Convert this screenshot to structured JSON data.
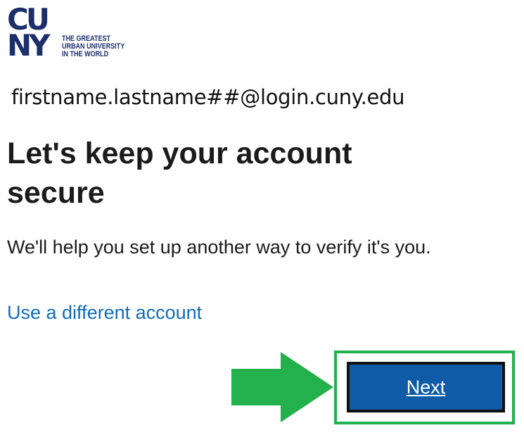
{
  "logo": {
    "letters_top": "CU",
    "letters_bottom": "NY",
    "tagline": [
      "THE GREATEST",
      "URBAN UNIVERSITY",
      "IN THE WORLD"
    ],
    "color": "#1d2f6b"
  },
  "account": {
    "email": "firstname.lastname##@login.cuny.edu"
  },
  "page": {
    "title": "Let's keep your account secure",
    "description": "We'll help you set up another way to verify it's you.",
    "alt_link": "Use a different account"
  },
  "actions": {
    "next_label": "Next",
    "button_color": "#0f5ba7",
    "link_color": "#0f6cbd",
    "highlight_color": "#22b14c",
    "annotation": "green-arrow-icon"
  }
}
